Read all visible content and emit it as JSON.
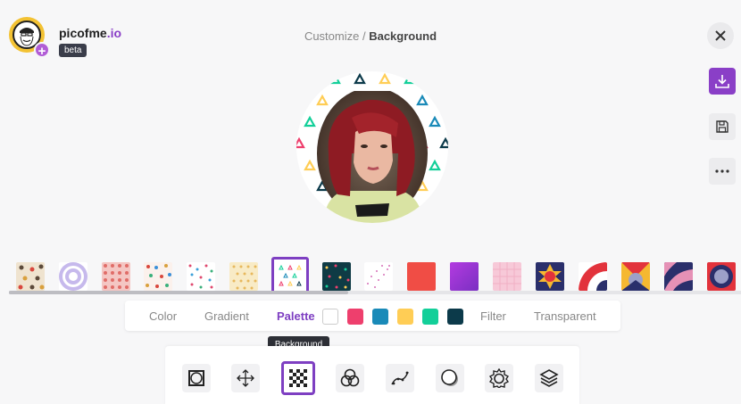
{
  "brand": {
    "name": "picofme",
    "tld": ".io",
    "badge": "beta"
  },
  "breadcrumb": {
    "parent": "Customize",
    "separator": " / ",
    "current": "Background"
  },
  "colors": {
    "accent": "#7e3fc2",
    "brand_purple": "#8a3fc7",
    "avatar_bg": "#f3c233"
  },
  "icons": {
    "close": "close-icon",
    "download": "download-icon",
    "save": "floppy-disk-icon",
    "more": "more-dots-icon"
  },
  "backgrounds": [
    "tan-dots-pattern",
    "lavender-concentric-circles",
    "pink-grid-pattern",
    "color-dots-pattern",
    "confetti-dots-pattern",
    "beige-dots-pattern",
    "triangles-pattern-selected",
    "teal-confetti-pattern",
    "pink-speckle-pattern",
    "solid-red",
    "purple-gradient",
    "pink-check-pattern",
    "navy-sunburst",
    "red-quarter-circles",
    "bauhaus-triangles",
    "navy-pink-waves",
    "red-navy-circle"
  ],
  "tabs": {
    "color": "Color",
    "gradient": "Gradient",
    "palette": "Palette",
    "filter": "Filter",
    "transparent": "Transparent"
  },
  "palette_colors": [
    "#ffffff",
    "#ee3f6d",
    "#1a8ab8",
    "#ffcd55",
    "#13cf99",
    "#0c3a4a"
  ],
  "tooltip": "Background",
  "tools": [
    "frame-icon",
    "move-icon",
    "background-icon",
    "blend-icon",
    "curve-icon",
    "shadow-icon",
    "badge-icon",
    "layers-icon"
  ]
}
